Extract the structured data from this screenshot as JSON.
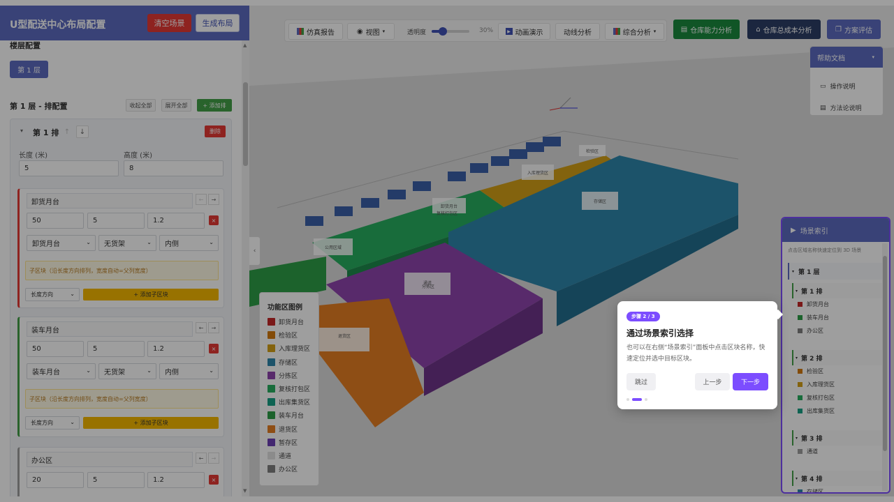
{
  "app": {
    "title": "U型配送中心布局配置",
    "clear_label": "清空场景",
    "generate_label": "生成布局"
  },
  "floor_config": {
    "label": "楼层配置",
    "floor_tab": "第 1 层"
  },
  "row_config": {
    "title": "第 1 层 - 排配置",
    "collapse_all": "收起全部",
    "expand_all": "展开全部",
    "add_row": "+ 添加排",
    "row": {
      "title": "第 1 排",
      "up_arrow": "↑",
      "down_arrow": "↓",
      "delete": "删除",
      "length_label": "长度 (米)",
      "length_value": "5",
      "height_label": "高度 (米)",
      "height_value": "8"
    }
  },
  "blocks": [
    {
      "name": "卸货月台",
      "color": "#e53935",
      "v1": "50",
      "v2": "5",
      "v3": "1.2",
      "type": "卸货月台",
      "rack": "无货架",
      "side": "内侧",
      "hint": "子区块（沿长度方向排列，宽度自动=父列宽度）",
      "direction": "长度方向",
      "add_sub": "+ 添加子区块"
    },
    {
      "name": "装车月台",
      "color": "#43a047",
      "v1": "50",
      "v2": "5",
      "v3": "1.2",
      "type": "装车月台",
      "rack": "无货架",
      "side": "内侧",
      "hint": "子区块（沿长度方向排列，宽度自动=父列宽度）",
      "direction": "长度方向",
      "add_sub": "+ 添加子区块"
    },
    {
      "name": "办公区",
      "color": "#9e9e9e",
      "v1": "20",
      "v2": "5",
      "v3": "1.2"
    }
  ],
  "toolbar": {
    "report": "仿真报告",
    "view": "视图",
    "opacity_label": "透明度",
    "opacity_value": "30%",
    "opacity": 0.3,
    "animation": "动画演示",
    "flow": "动线分析",
    "overall": "综合分析"
  },
  "actions": {
    "capacity": "仓库能力分析",
    "cost": "仓库总成本分析",
    "evaluate": "方案评估",
    "capacity_color": "#1b8a3e",
    "cost_color": "#2c3e66",
    "evaluate_color": "#5c6bc0"
  },
  "help": {
    "title": "帮助文档",
    "items": [
      "操作说明",
      "方法论说明"
    ]
  },
  "scene_labels": [
    "公用区域",
    "通道",
    "卸货月台",
    "入库理货区",
    "存储区",
    "检验区",
    "分拣区",
    "复核打包区",
    "退货区"
  ],
  "legend": {
    "title": "功能区图例",
    "items": [
      {
        "label": "卸货月台",
        "color": "#c62828"
      },
      {
        "label": "检验区",
        "color": "#d47a0d"
      },
      {
        "label": "入库理货区",
        "color": "#d4a017"
      },
      {
        "label": "存储区",
        "color": "#2e86ab"
      },
      {
        "label": "分拣区",
        "color": "#8e44ad"
      },
      {
        "label": "复核打包区",
        "color": "#27ae60"
      },
      {
        "label": "出库集货区",
        "color": "#16a085"
      },
      {
        "label": "装车月台",
        "color": "#2e9e48"
      },
      {
        "label": "退货区",
        "color": "#e67e22"
      },
      {
        "label": "暂存区",
        "color": "#6c3fb5"
      },
      {
        "label": "通道",
        "color": "#e0e0e0"
      },
      {
        "label": "办公区",
        "color": "#808080"
      }
    ]
  },
  "scene_index": {
    "title": "场景索引",
    "subtitle": "点击区域名称快速定位到 3D 场景",
    "floor": "第 1 层",
    "rows": [
      {
        "title": "第 1 排",
        "items": [
          {
            "label": "卸货月台",
            "color": "#c62828"
          },
          {
            "label": "装车月台",
            "color": "#2e9e48"
          },
          {
            "label": "办公区",
            "color": "#808080"
          }
        ]
      },
      {
        "title": "第 2 排",
        "items": [
          {
            "label": "检验区",
            "color": "#d47a0d"
          },
          {
            "label": "入库理货区",
            "color": "#d4a017"
          },
          {
            "label": "复核打包区",
            "color": "#27ae60"
          },
          {
            "label": "出库集货区",
            "color": "#16a085"
          }
        ]
      },
      {
        "title": "第 3 排",
        "items": [
          {
            "label": "通道",
            "color": "#9e9e9e"
          }
        ]
      },
      {
        "title": "第 4 排",
        "items": [
          {
            "label": "存储区",
            "color": "#2e86ab"
          }
        ]
      }
    ]
  },
  "guide": {
    "step": "步骤 2 / 3",
    "title": "通过场景索引选择",
    "body": "也可以在右侧“场景索引”面板中点击区块名称，快速定位并选中目标区块。",
    "skip": "跳过",
    "prev": "上一步",
    "next": "下一步"
  }
}
